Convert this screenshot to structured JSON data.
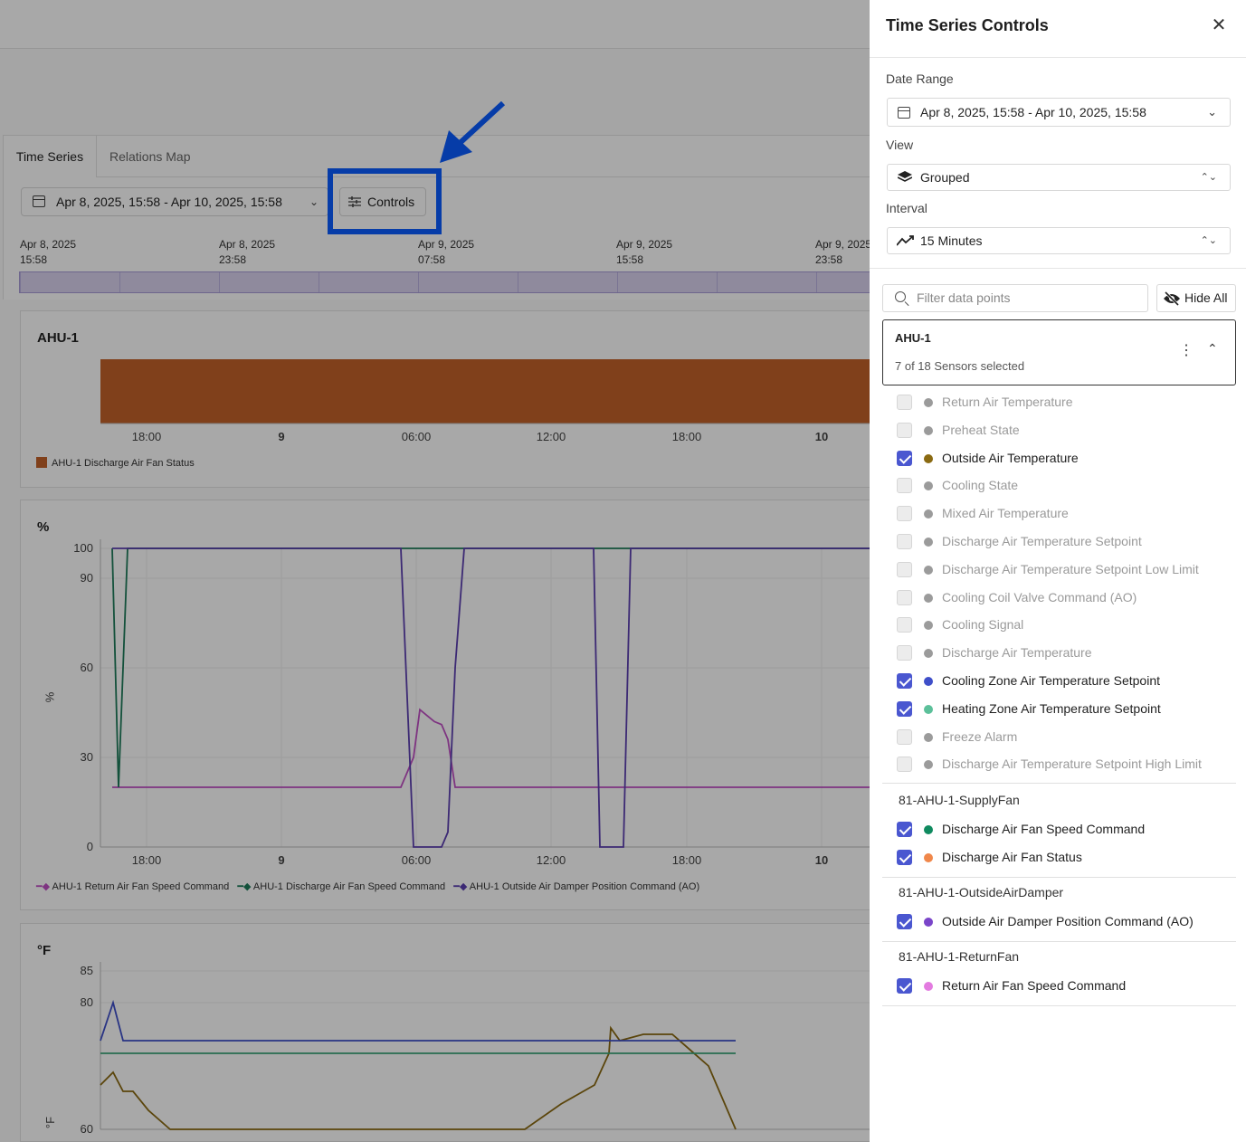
{
  "background": {
    "tabs": [
      {
        "label": "Time Series",
        "active": true
      },
      {
        "label": "Relations Map",
        "active": false
      }
    ],
    "date_range": "Apr 8, 2025, 15:58 - Apr 10, 2025, 15:58",
    "controls_label": "Controls",
    "timeline_labels": [
      {
        "date": "Apr 8, 2025",
        "time": "15:58"
      },
      {
        "date": "Apr 8, 2025",
        "time": "23:58"
      },
      {
        "date": "Apr 9, 2025",
        "time": "07:58"
      },
      {
        "date": "Apr 9, 2025",
        "time": "15:58"
      },
      {
        "date": "Apr 9, 2025",
        "time": "23:58"
      }
    ],
    "x_ticks": [
      "18:00",
      "9",
      "06:00",
      "12:00",
      "18:00",
      "10"
    ]
  },
  "chart_data": [
    {
      "type": "bar",
      "title": "AHU-1",
      "categories": [
        "Apr 8, 2025 15:58",
        "Apr 10, 2025 15:58"
      ],
      "series": [
        {
          "name": "AHU-1 Discharge Air Fan Status",
          "values": [
            1,
            1
          ],
          "color": "#c2622a"
        }
      ]
    },
    {
      "type": "line",
      "ylabel": "%",
      "unit": "%",
      "ylim": [
        0,
        100
      ],
      "y_ticks": [
        0,
        30,
        60,
        90,
        100
      ],
      "x": [
        "16:00",
        "16:15",
        "16:30",
        "16:45",
        "17:00",
        "05:45",
        "06:00",
        "06:15",
        "06:30",
        "06:45",
        "07:00",
        "07:15",
        "07:30",
        "07:45",
        "08:00",
        "13:45",
        "14:00",
        "15:30",
        "15:45",
        "16:00"
      ],
      "series": [
        {
          "name": "AHU-1 Return Air Fan Speed Command",
          "color": "#c04fc4",
          "values": [
            20,
            20,
            20,
            20,
            20,
            20,
            30,
            46,
            44,
            42,
            41,
            36,
            20,
            20,
            20,
            20,
            20,
            20,
            20,
            20
          ]
        },
        {
          "name": "AHU-1 Discharge Air Fan Speed Command",
          "color": "#1e7b5a",
          "values": [
            100,
            20,
            100,
            100,
            100,
            100,
            100,
            100,
            100,
            100,
            100,
            100,
            100,
            100,
            100,
            100,
            100,
            100,
            100,
            100
          ]
        },
        {
          "name": "AHU-1 Outside Air Damper Position Command (AO)",
          "color": "#5b3fb0",
          "values": [
            100,
            100,
            100,
            100,
            100,
            100,
            0,
            0,
            0,
            0,
            0,
            5,
            60,
            100,
            100,
            100,
            0,
            0,
            100,
            100
          ]
        }
      ]
    },
    {
      "type": "line",
      "ylabel": "°F",
      "unit": "°F",
      "ylim": [
        60,
        85
      ],
      "y_ticks": [
        60,
        80,
        85
      ],
      "x": [
        "16:00",
        "16:30",
        "17:00",
        "17:30",
        "18:00",
        "18:30",
        "05:00",
        "07:00",
        "09:00",
        "11:00",
        "12:00",
        "12:30",
        "13:00",
        "14:00",
        "15:00",
        "16:00"
      ],
      "series": [
        {
          "name": "Outside Air Temperature",
          "color": "#8a6a12",
          "values": [
            67,
            69,
            66,
            66,
            63,
            60,
            60,
            64,
            67,
            72,
            76,
            74,
            75,
            75,
            70,
            60
          ]
        },
        {
          "name": "Cooling Zone Air Temperature Setpoint",
          "color": "#3f4fc9",
          "values": [
            74,
            80,
            74,
            74,
            74,
            74,
            74,
            74,
            74,
            74,
            74,
            74,
            74,
            74,
            74,
            74
          ]
        },
        {
          "name": "Heating Zone Air Temperature Setpoint",
          "color": "#3da67a",
          "values": [
            72,
            72,
            72,
            72,
            72,
            72,
            72,
            72,
            72,
            72,
            72,
            72,
            72,
            72,
            72,
            72
          ]
        }
      ]
    }
  ],
  "panel": {
    "title": "Time Series Controls",
    "date_range_label": "Date Range",
    "date_range_value": "Apr 8, 2025, 15:58 - Apr 10, 2025, 15:58",
    "view_label": "View",
    "view_value": "Grouped",
    "interval_label": "Interval",
    "interval_value": "15 Minutes",
    "filter_placeholder": "Filter data points",
    "hide_all_label": "Hide All",
    "group": {
      "name": "AHU-1",
      "subtitle": "7 of 18 Sensors selected"
    },
    "sensors": [
      {
        "label": "Return Air Temperature",
        "checked": false,
        "color": "#9b9b9b"
      },
      {
        "label": "Preheat State",
        "checked": false,
        "color": "#9b9b9b"
      },
      {
        "label": "Outside Air Temperature",
        "checked": true,
        "color": "#8a6a12"
      },
      {
        "label": "Cooling State",
        "checked": false,
        "color": "#9b9b9b"
      },
      {
        "label": "Mixed Air Temperature",
        "checked": false,
        "color": "#9b9b9b"
      },
      {
        "label": "Discharge Air Temperature Setpoint",
        "checked": false,
        "color": "#9b9b9b"
      },
      {
        "label": "Discharge Air Temperature Setpoint Low Limit",
        "checked": false,
        "color": "#9b9b9b"
      },
      {
        "label": "Cooling Coil Valve Command (AO)",
        "checked": false,
        "color": "#9b9b9b"
      },
      {
        "label": "Cooling Signal",
        "checked": false,
        "color": "#9b9b9b"
      },
      {
        "label": "Discharge Air Temperature",
        "checked": false,
        "color": "#9b9b9b"
      },
      {
        "label": "Cooling Zone Air Temperature Setpoint",
        "checked": true,
        "color": "#3f4fc9"
      },
      {
        "label": "Heating Zone Air Temperature Setpoint",
        "checked": true,
        "color": "#5cc09a"
      },
      {
        "label": "Freeze Alarm",
        "checked": false,
        "color": "#9b9b9b"
      },
      {
        "label": "Discharge Air Temperature Setpoint High Limit",
        "checked": false,
        "color": "#9b9b9b"
      }
    ],
    "subgroups": [
      {
        "name": "81-AHU-1-SupplyFan",
        "items": [
          {
            "label": "Discharge Air Fan Speed Command",
            "checked": true,
            "color": "#0f8a5f"
          },
          {
            "label": "Discharge Air Fan Status",
            "checked": true,
            "color": "#f0874a"
          }
        ]
      },
      {
        "name": "81-AHU-1-OutsideAirDamper",
        "items": [
          {
            "label": "Outside Air Damper Position Command (AO)",
            "checked": true,
            "color": "#7a45c9"
          }
        ]
      },
      {
        "name": "81-AHU-1-ReturnFan",
        "items": [
          {
            "label": "Return Air Fan Speed Command",
            "checked": true,
            "color": "#e37be0"
          }
        ]
      }
    ]
  }
}
